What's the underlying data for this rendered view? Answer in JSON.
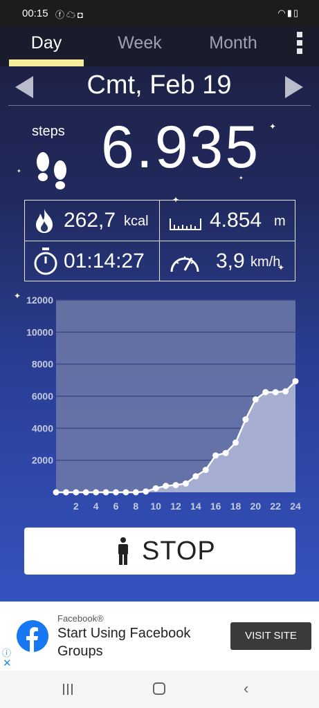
{
  "status_bar": {
    "time": "00:15",
    "left_icons": [
      "facebook-icon",
      "cloud-icon",
      "instagram-icon"
    ],
    "right_icons": [
      "wifi-icon",
      "signal-icon",
      "battery-icon"
    ]
  },
  "tabs": [
    {
      "label": "Day",
      "active": true
    },
    {
      "label": "Week",
      "active": false
    },
    {
      "label": "Month",
      "active": false
    }
  ],
  "date_nav": {
    "date": "Cmt, Feb 19"
  },
  "steps": {
    "label": "steps",
    "value": "6.935"
  },
  "stats": {
    "calories": {
      "value": "262,7",
      "unit": "kcal"
    },
    "distance": {
      "value": "4.854",
      "unit": "m"
    },
    "duration": {
      "value": "01:14:27"
    },
    "speed": {
      "value": "3,9",
      "unit": "km/h"
    }
  },
  "chart_data": {
    "type": "area",
    "title": "",
    "xlabel": "",
    "ylabel": "",
    "x_ticks": [
      2,
      4,
      6,
      8,
      10,
      12,
      14,
      16,
      18,
      20,
      22,
      24
    ],
    "y_ticks": [
      2000,
      4000,
      6000,
      8000,
      10000,
      12000
    ],
    "xlim": [
      0,
      24
    ],
    "ylim": [
      0,
      12000
    ],
    "grid": true,
    "x": [
      0,
      1,
      2,
      3,
      4,
      5,
      6,
      7,
      8,
      9,
      10,
      11,
      12,
      13,
      14,
      15,
      16,
      17,
      18,
      19,
      20,
      21,
      22,
      23,
      24
    ],
    "values": [
      0,
      0,
      0,
      0,
      0,
      0,
      0,
      0,
      0,
      50,
      250,
      400,
      450,
      550,
      1000,
      1400,
      2300,
      2450,
      3100,
      4550,
      5800,
      6250,
      6250,
      6300,
      6935
    ]
  },
  "stop_button": {
    "label": "STOP"
  },
  "ad": {
    "source": "Facebook®",
    "title": "Start Using Facebook Groups",
    "cta": "VISIT SITE",
    "info_icon": "ⓘ",
    "close_icon": "✕"
  },
  "colors": {
    "tab_underline": "#f5ec9a",
    "chart_area": "#a6afd2",
    "chart_line": "#ffffff",
    "background_top": "#1c1f3f",
    "background_bottom": "#3453c0"
  }
}
